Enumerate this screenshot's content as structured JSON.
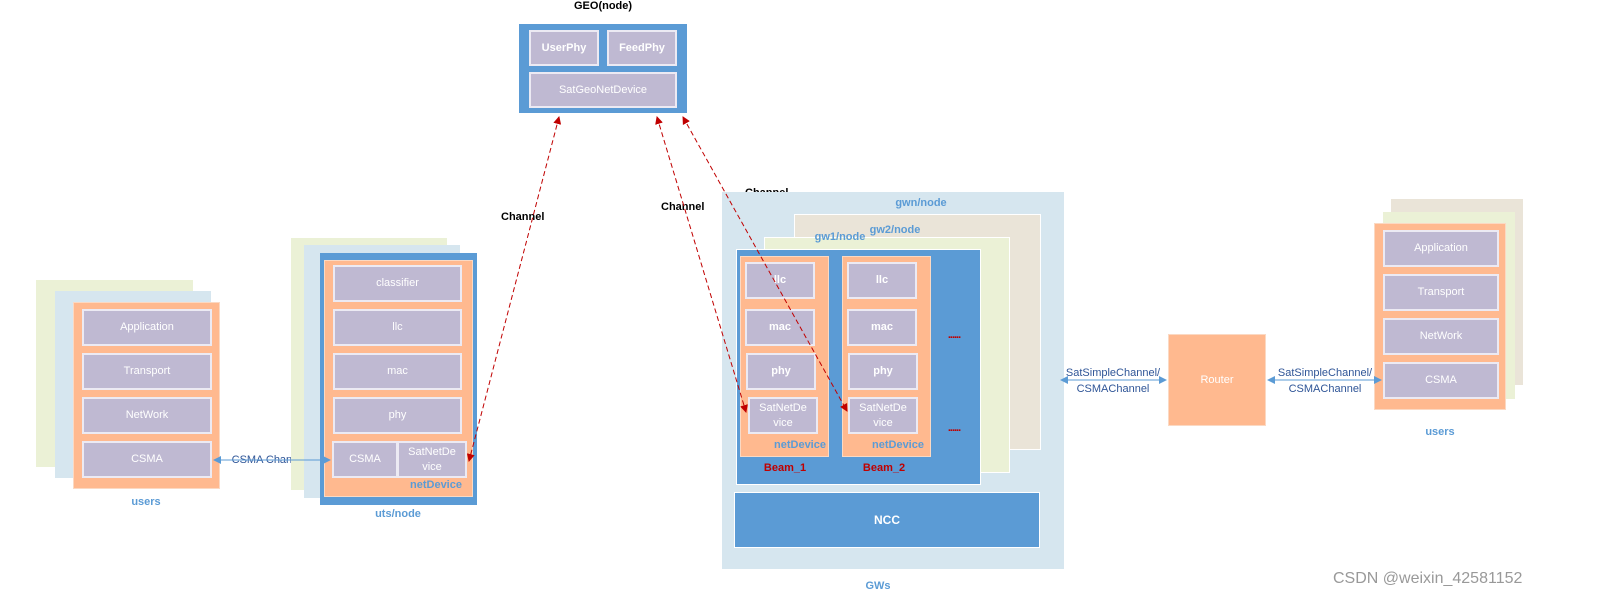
{
  "geo": {
    "title": "GEO(node)",
    "user_phy": "UserPhy",
    "feed_phy": "FeedPhy",
    "net_device": "SatGeoNetDevice"
  },
  "channel_labels": [
    "Channel",
    "Channel",
    "Channel"
  ],
  "left_users": {
    "layers": [
      "Application",
      "Transport",
      "NetWork",
      "CSMA"
    ],
    "label": "users"
  },
  "csma_link": "CSMA Channels",
  "ut": {
    "layers": [
      "classifier",
      "llc",
      "mac",
      "phy"
    ],
    "csma": "CSMA",
    "sat_net_device": "SatNetDe vice",
    "net_device_label": "netDevice",
    "label": "uts/node"
  },
  "gws": {
    "gwn": "gwn/node",
    "gw2": "gw2/node",
    "gw1": "gw1/node",
    "beams": [
      {
        "layers": [
          "llc",
          "mac",
          "phy"
        ],
        "sat_net_device": "SatNetDe vice",
        "net_device_label": "netDevice",
        "label": "Beam_1"
      },
      {
        "layers": [
          "llc",
          "mac",
          "phy"
        ],
        "sat_net_device": "SatNetDe vice",
        "net_device_label": "netDevice",
        "label": "Beam_2"
      }
    ],
    "ellipsis": "......",
    "ncc": "NCC",
    "label": "GWs"
  },
  "links": {
    "gw_router": [
      "SatSimpleChannel/",
      "CSMAChannel"
    ],
    "router_users": [
      "SatSimpleChannel/",
      "CSMAChannel"
    ]
  },
  "router": "Router",
  "right_users": {
    "layers": [
      "Application",
      "Transport",
      "NetWork",
      "CSMA"
    ],
    "label": "users"
  },
  "watermark": "CSDN @weixin_42581152",
  "colors": {
    "layer_box": "#BFB9D2",
    "container_orange": "#FFB98F",
    "node_blue": "#5B9BD5",
    "channel_red": "#C00000",
    "link_blue": "#5B9BD5"
  }
}
